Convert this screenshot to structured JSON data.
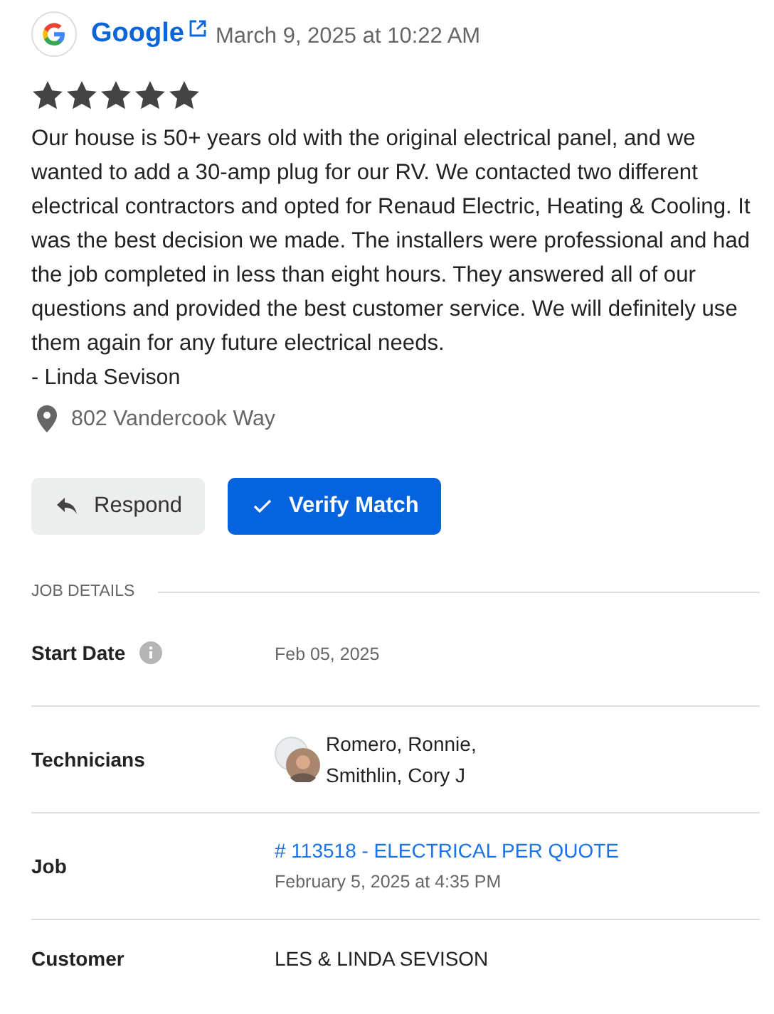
{
  "review": {
    "source": "Google",
    "date": "March 9, 2025 at 10:22 AM",
    "stars": 5,
    "text": "Our house is 50+ years old with the original electrical panel, and we wanted to add a 30-amp plug for our RV. We contacted two different electrical contractors and opted for Renaud Electric, Heating & Cooling. It was the best decision we made. The installers were professional and had the job completed in less than eight hours. They answered all of our questions and provided the best customer service. We will definitely use them again for any future electrical needs.",
    "author": "- Linda Sevison",
    "location": "802 Vandercook Way"
  },
  "buttons": [
    {
      "kind": "respond",
      "label": "Respond"
    },
    {
      "kind": "verify",
      "label": "Verify Match"
    }
  ],
  "job_details": {
    "title": "JOB DETAILS",
    "rows": [
      {
        "kind": "date",
        "label": "Start Date",
        "info": true,
        "value": "Feb 05, 2025"
      },
      {
        "kind": "people",
        "label": "Technicians",
        "lines": [
          "Romero, Ronnie,",
          "Smithlin, Cory J"
        ]
      },
      {
        "kind": "job",
        "label": "Job",
        "link": "# 113518 - ELECTRICAL PER QUOTE",
        "sub": "February 5, 2025 at 4:35 PM"
      },
      {
        "kind": "text",
        "label": "Customer",
        "value": "LES & LINDA SEVISON"
      }
    ]
  }
}
